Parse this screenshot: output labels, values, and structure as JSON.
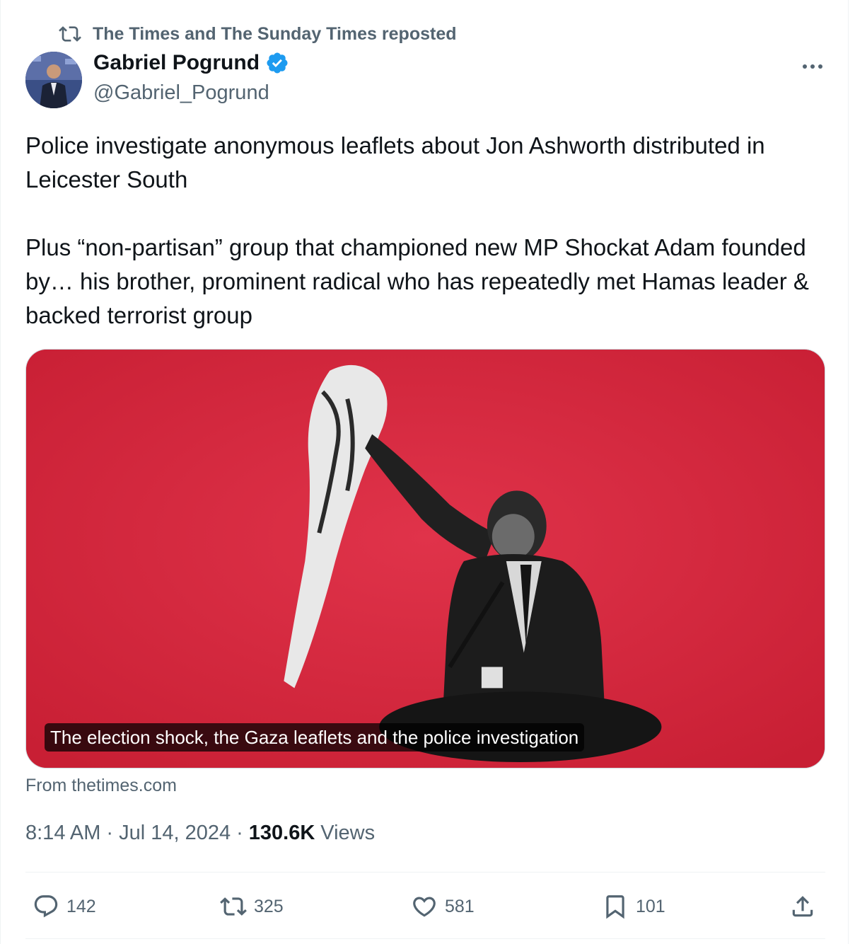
{
  "repost": {
    "text": "The Times and The Sunday Times reposted",
    "icon": "repost-icon"
  },
  "author": {
    "name": "Gabriel Pogrund",
    "handle": "@Gabriel_Pogrund",
    "verified": true,
    "verified_color": "#1d9bf0"
  },
  "tweet": {
    "text": "Police investigate anonymous leaflets about Jon Ashworth distributed in Leicester South\n\nPlus “non-partisan” group that championed new MP Shockat Adam founded by… his brother, prominent radical who has repeatedly met Hamas leader & backed terrorist group"
  },
  "card": {
    "caption": "The election shock, the Gaza leaflets and the police investigation",
    "background_color": "#d8283c",
    "source": "From thetimes.com"
  },
  "meta": {
    "time": "8:14 AM",
    "separator": "·",
    "date": "Jul 14, 2024",
    "views_count": "130.6K",
    "views_label": "Views"
  },
  "actions": {
    "replies": "142",
    "reposts": "325",
    "likes": "581",
    "bookmarks": "101"
  },
  "colors": {
    "secondary_text": "#536471",
    "primary_text": "#0f1419",
    "divider": "#eff3f4"
  }
}
